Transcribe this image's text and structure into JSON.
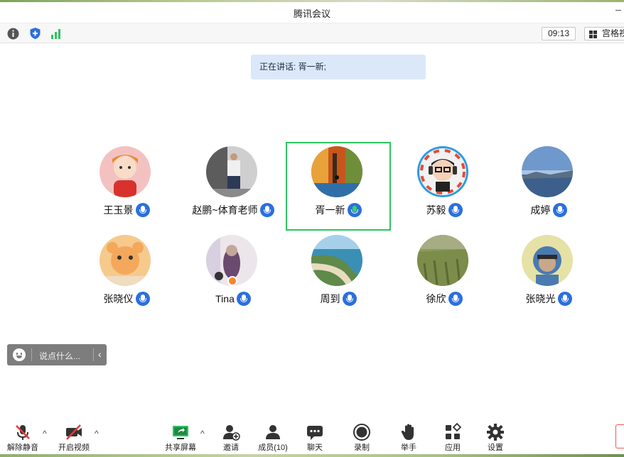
{
  "window": {
    "title": "腾讯会议"
  },
  "infobar": {
    "time": "09:13",
    "view_label": "宫格视图"
  },
  "speaking": {
    "label": "正在讲话: 胥一新;"
  },
  "participants": [
    {
      "name": "王玉景",
      "mic": "on"
    },
    {
      "name": "赵鹏~体育老师",
      "mic": "on"
    },
    {
      "name": "胥一新",
      "mic": "speaking"
    },
    {
      "name": "苏毅",
      "mic": "on"
    },
    {
      "name": "成婷",
      "mic": "on"
    },
    {
      "name": "张晓仪",
      "mic": "on"
    },
    {
      "name": "Tina",
      "mic": "on"
    },
    {
      "name": "周到",
      "mic": "on"
    },
    {
      "name": "徐欣",
      "mic": "on"
    },
    {
      "name": "张晓光",
      "mic": "on"
    }
  ],
  "chat": {
    "placeholder": "说点什么...",
    "collapse": "‹"
  },
  "toolbar": {
    "unmute": "解除静音",
    "start_video": "开启视频",
    "share_screen": "共享屏幕",
    "invite": "邀请",
    "members": "成员(10)",
    "chat": "聊天",
    "record": "录制",
    "raise_hand": "举手",
    "apps": "应用",
    "settings": "设置",
    "caret": "^"
  },
  "colors": {
    "active_border": "#2ec462",
    "mic_blue": "#2b6fde",
    "speaking_bg": "#dbe8f9"
  }
}
